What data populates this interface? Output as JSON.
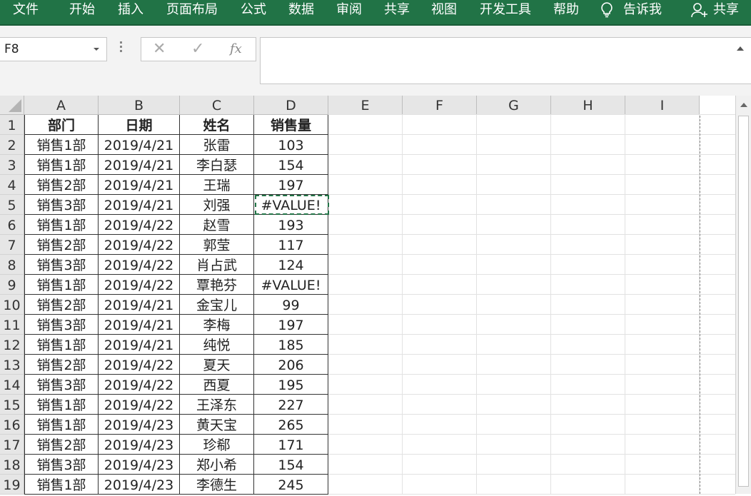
{
  "ribbon": {
    "tabs": [
      "文件",
      "开始",
      "插入",
      "页面布局",
      "公式",
      "数据",
      "审阅",
      "共享",
      "视图",
      "开发工具",
      "帮助"
    ],
    "tell_me": "告诉我",
    "share": "共享"
  },
  "formula_bar": {
    "name_box": "F8",
    "cancel_icon": "✕",
    "enter_icon": "✓",
    "fx_label": "fx",
    "formula": ""
  },
  "columns": [
    "A",
    "B",
    "C",
    "D",
    "E",
    "F",
    "G",
    "H",
    "I"
  ],
  "headers": [
    "部门",
    "日期",
    "姓名",
    "销售量"
  ],
  "rows": [
    [
      "销售1部",
      "2019/4/21",
      "张雷",
      "103"
    ],
    [
      "销售1部",
      "2019/4/21",
      "李白瑟",
      "154"
    ],
    [
      "销售2部",
      "2019/4/21",
      "王瑞",
      "197"
    ],
    [
      "销售3部",
      "2019/4/21",
      "刘强",
      "#VALUE!"
    ],
    [
      "销售1部",
      "2019/4/22",
      "赵雪",
      "193"
    ],
    [
      "销售2部",
      "2019/4/22",
      "郭莹",
      "117"
    ],
    [
      "销售3部",
      "2019/4/22",
      "肖占武",
      "124"
    ],
    [
      "销售1部",
      "2019/4/22",
      "覃艳芬",
      "#VALUE!"
    ],
    [
      "销售2部",
      "2019/4/21",
      "金宝儿",
      "99"
    ],
    [
      "销售3部",
      "2019/4/21",
      "李梅",
      "197"
    ],
    [
      "销售1部",
      "2019/4/21",
      "纯悦",
      "185"
    ],
    [
      "销售2部",
      "2019/4/22",
      "夏天",
      "206"
    ],
    [
      "销售3部",
      "2019/4/22",
      "西夏",
      "195"
    ],
    [
      "销售1部",
      "2019/4/22",
      "王泽东",
      "227"
    ],
    [
      "销售1部",
      "2019/4/23",
      "黄天宝",
      "265"
    ],
    [
      "销售2部",
      "2019/4/23",
      "珍郗",
      "171"
    ],
    [
      "销售3部",
      "2019/4/23",
      "郑小希",
      "154"
    ],
    [
      "销售1部",
      "2019/4/23",
      "李德生",
      "245"
    ]
  ],
  "selected_cell": "F8",
  "copy_marquee_cell": "D5",
  "colors": {
    "ribbon": "#217346",
    "marquee": "#217346",
    "header_bg": "#e6e6e6"
  }
}
